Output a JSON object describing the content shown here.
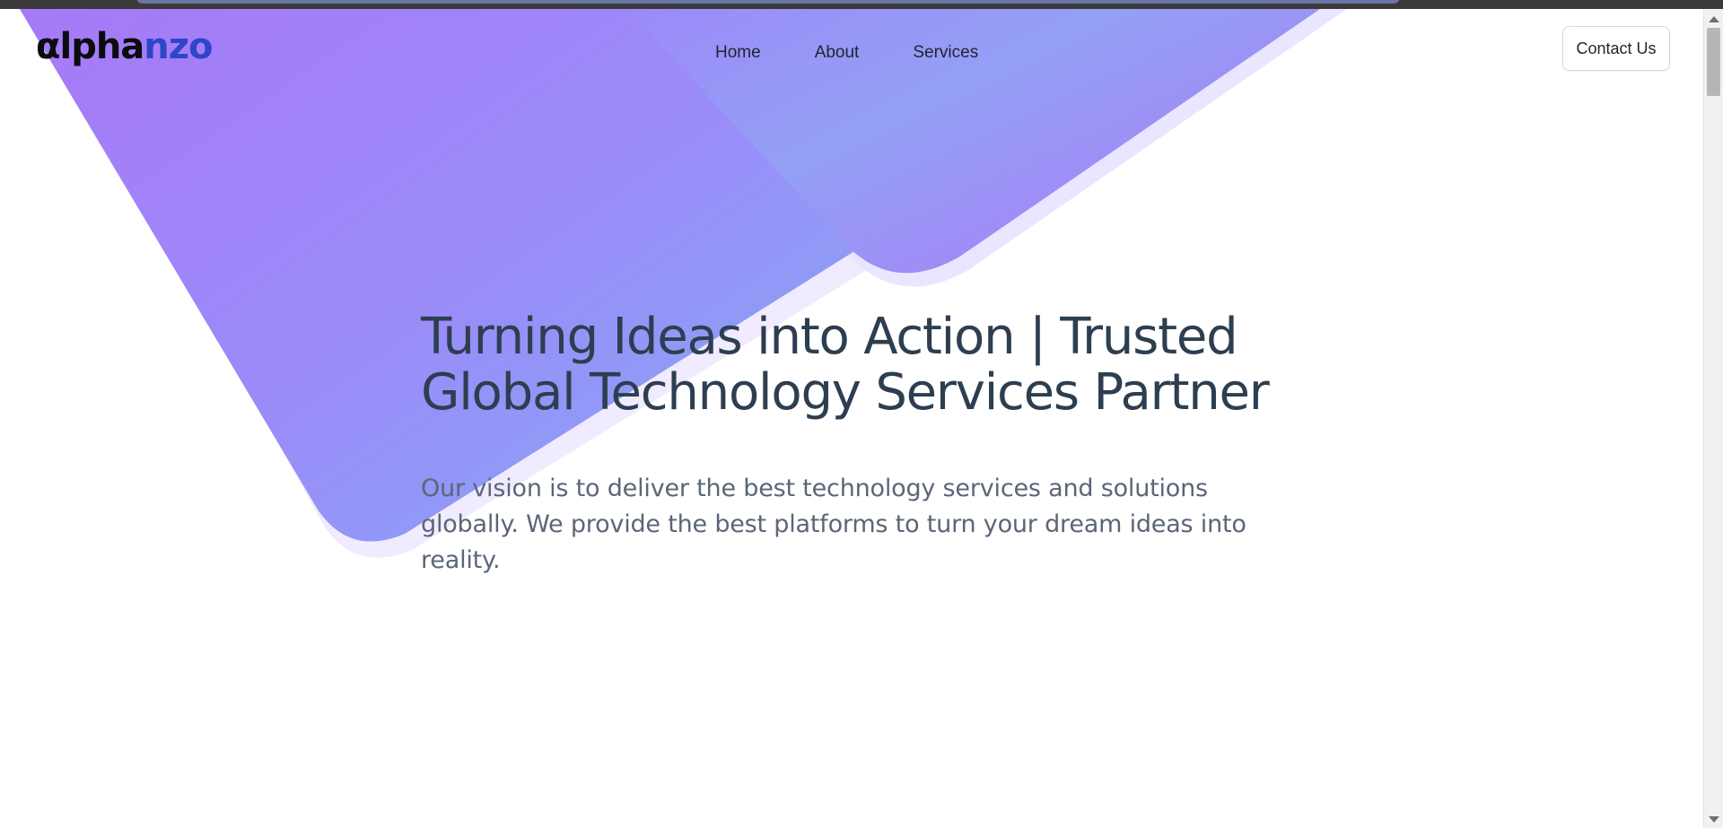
{
  "header": {
    "logo": {
      "part1": "αlpha",
      "part2": "nzo"
    },
    "nav": [
      {
        "label": "Home"
      },
      {
        "label": "About"
      },
      {
        "label": "Services"
      }
    ],
    "cta_label": "Contact Us"
  },
  "hero": {
    "title": "Turning Ideas into Action | Trusted Global Technology Services Partner",
    "subtitle": "Our vision is to deliver the best technology services and solutions globally. We provide the best platforms to turn your dream ideas into reality."
  },
  "colors": {
    "brand_dark": "#0c0c10",
    "brand_blue": "#2f46c8",
    "gradient_start": "#a878f7",
    "gradient_mid": "#9a8cf8",
    "gradient_end": "#8d9ef6",
    "heading": "#2d3e50",
    "body_text": "#5b6677"
  }
}
